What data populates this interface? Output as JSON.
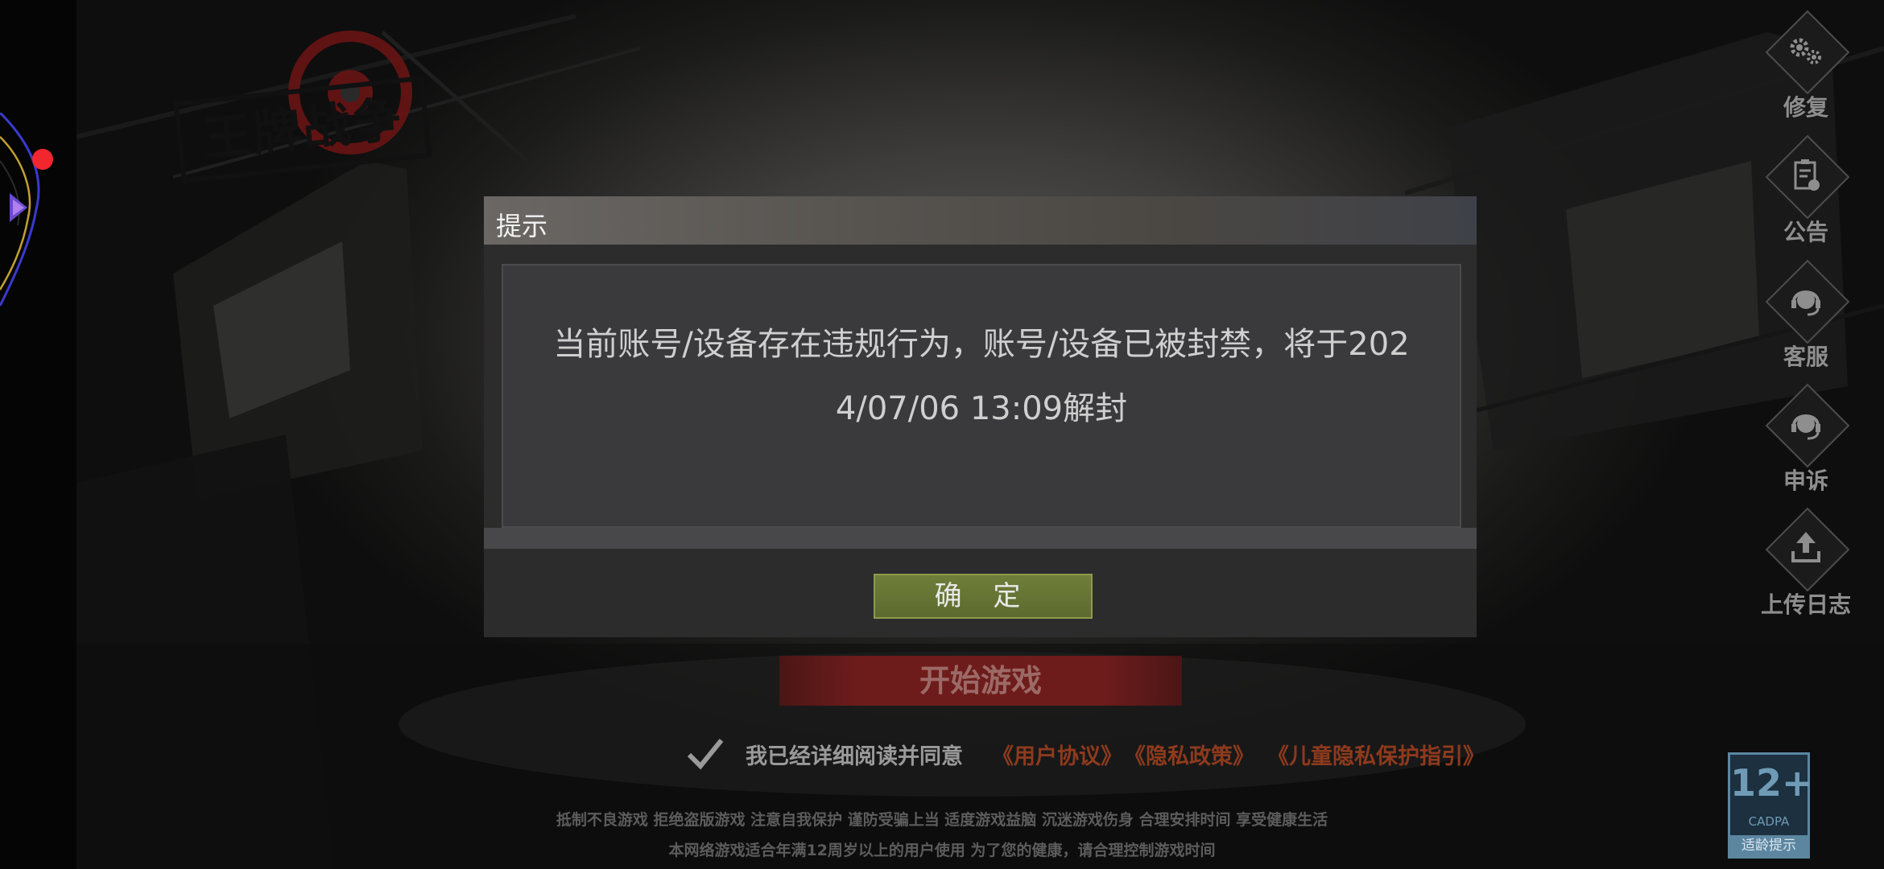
{
  "game": {
    "logo_text": "王牌战争"
  },
  "tools": [
    {
      "label": "修复",
      "icon": "gear-icon"
    },
    {
      "label": "公告",
      "icon": "notice-icon"
    },
    {
      "label": "客服",
      "icon": "headset-icon"
    },
    {
      "label": "申诉",
      "icon": "headset-icon"
    },
    {
      "label": "上传日志",
      "icon": "upload-icon"
    }
  ],
  "dialog": {
    "title": "提示",
    "message_line1": "当前账号/设备存在违规行为，账号/设备已被封禁，将于202",
    "message_line2": "4/07/06 13:09解封",
    "confirm_label": "确 定"
  },
  "start_button": {
    "label": "开始游戏"
  },
  "agreement": {
    "text": "我已经详细阅读并同意",
    "links": [
      "《用户协议》",
      "《隐私政策》",
      "《儿童隐私保护指引》"
    ]
  },
  "notices": {
    "line1": "抵制不良游戏 拒绝盗版游戏 注意自我保护 谨防受骗上当 适度游戏益脑 沉迷游戏伤身 合理安排时间 享受健康生活",
    "line2": "本网络游戏适合年满12周岁以上的用户使用    为了您的健康，请合理控制游戏时间"
  },
  "age_rating": {
    "age": "12+",
    "org": "CADPA",
    "label": "适龄提示"
  },
  "colors": {
    "accent_red": "#f2262f",
    "confirm_green": "#5d6a2e",
    "link_orange": "#8d3a1d"
  }
}
